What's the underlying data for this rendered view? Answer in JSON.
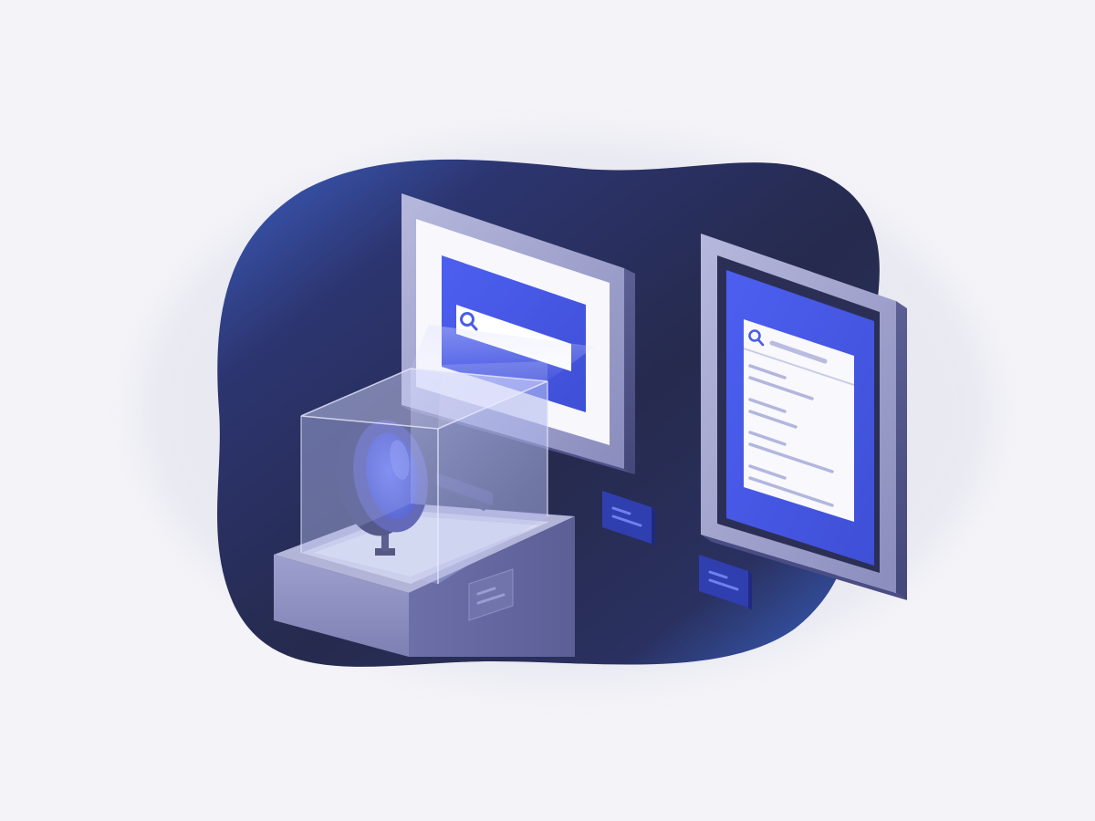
{
  "illustration": {
    "icons": [
      "search-icon",
      "magnifying-glass-icon"
    ],
    "colors": {
      "page_background": "#f3f3f8",
      "blob_dark": "#272a4c",
      "blob_blue": "#3a63c9",
      "screen_blue": "#4a5de6",
      "frame": "#8c8fc0",
      "pedestal_top": "#aeb0d6",
      "pedestal_front": "#8f92bf",
      "glass": "#b7bff0"
    }
  }
}
